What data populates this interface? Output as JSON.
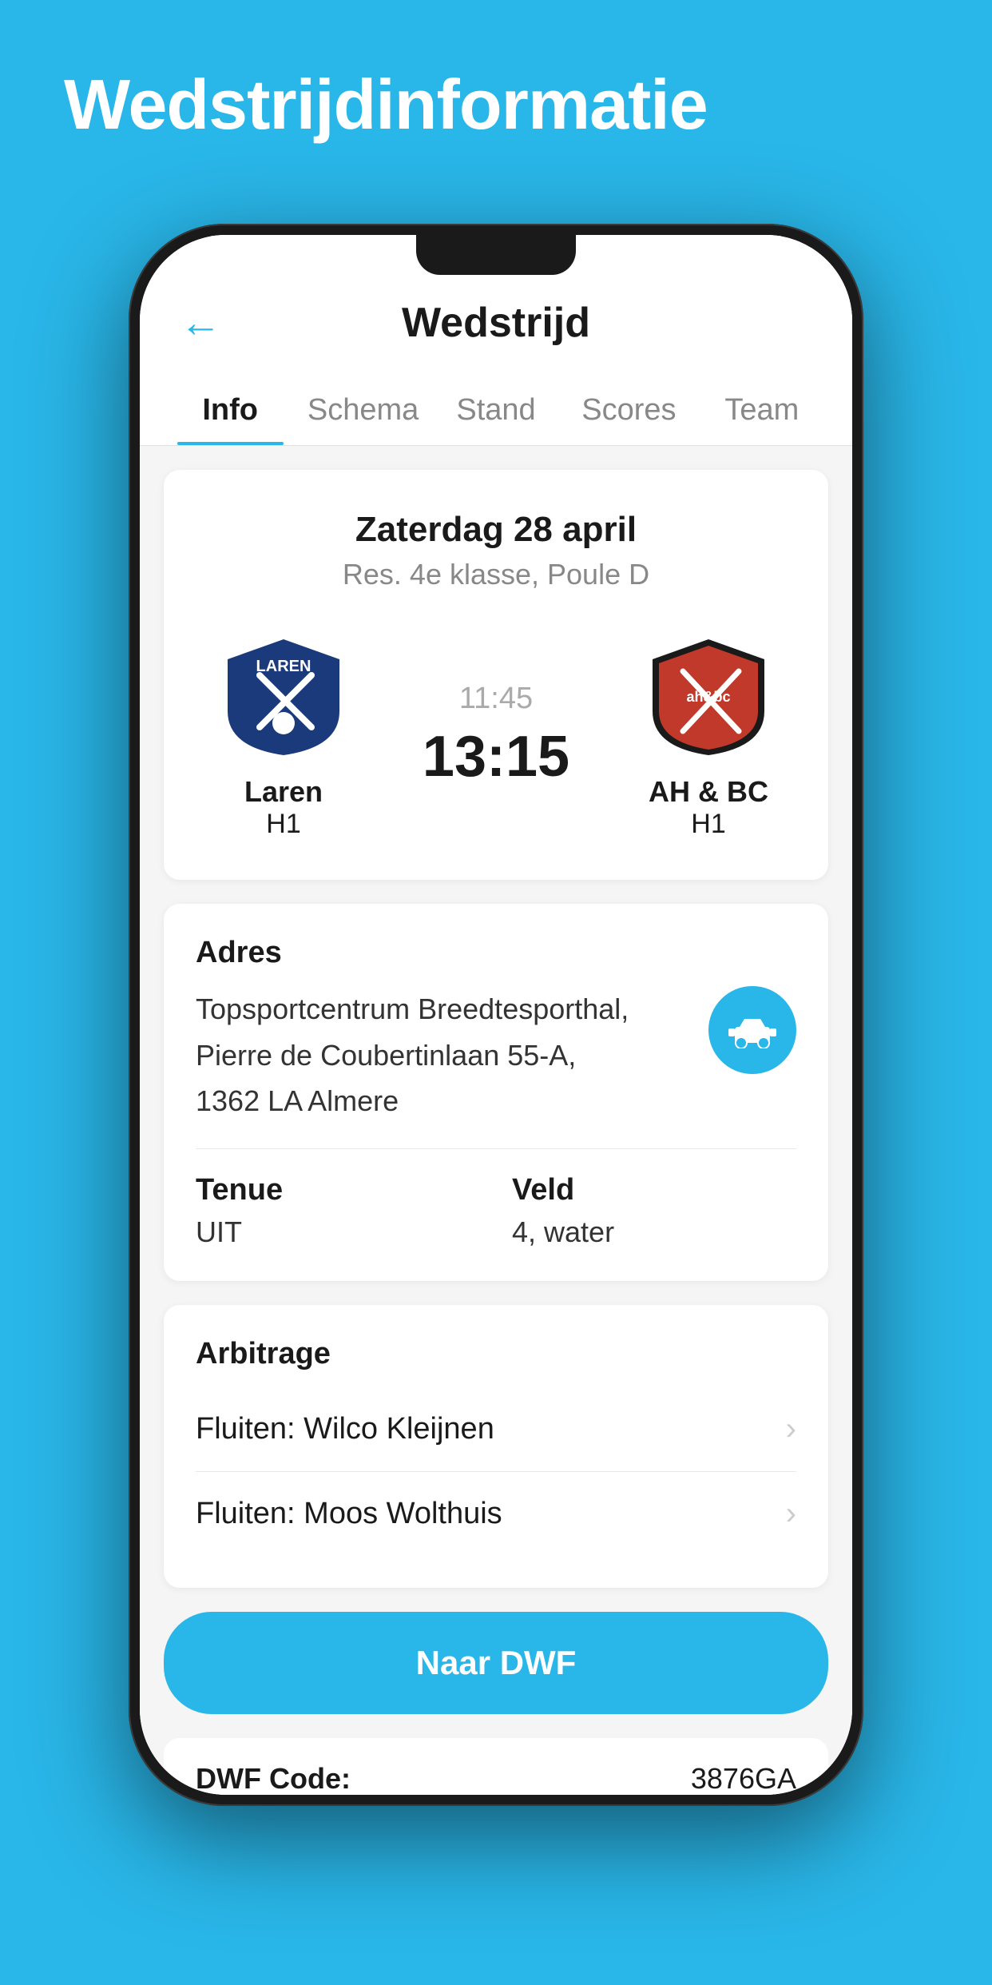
{
  "page": {
    "background_title": "Wedstrijdinformatie",
    "header": {
      "back_label": "←",
      "title": "Wedstrijd"
    },
    "tabs": [
      {
        "id": "info",
        "label": "Info",
        "active": true
      },
      {
        "id": "schema",
        "label": "Schema",
        "active": false
      },
      {
        "id": "stand",
        "label": "Stand",
        "active": false
      },
      {
        "id": "scores",
        "label": "Scores",
        "active": false
      },
      {
        "id": "team",
        "label": "Team",
        "active": false
      }
    ],
    "match": {
      "date": "Zaterdag 28 april",
      "competition": "Res. 4e klasse, Poule D",
      "time_planned": "11:45",
      "score": "13:15",
      "home_team": {
        "name": "Laren",
        "sub": "H1",
        "logo_alt": "Laren logo"
      },
      "away_team": {
        "name": "AH & BC",
        "sub": "H1",
        "logo_alt": "AH & BC logo"
      }
    },
    "address": {
      "label": "Adres",
      "line1": "Topsportcentrum Breedtesporthal,",
      "line2": "Pierre de Coubertinlaan 55-A,",
      "line3": "1362 LA Almere"
    },
    "tenue": {
      "label": "Tenue",
      "value": "UIT"
    },
    "veld": {
      "label": "Veld",
      "value": "4, water"
    },
    "arbitrage": {
      "label": "Arbitrage",
      "items": [
        {
          "text": "Fluiten: Wilco Kleijnen"
        },
        {
          "text": "Fluiten: Moos Wolthuis"
        }
      ]
    },
    "dwf": {
      "button_label": "Naar DWF",
      "code_label": "DWF Code:",
      "code_value": "3876GA"
    }
  }
}
